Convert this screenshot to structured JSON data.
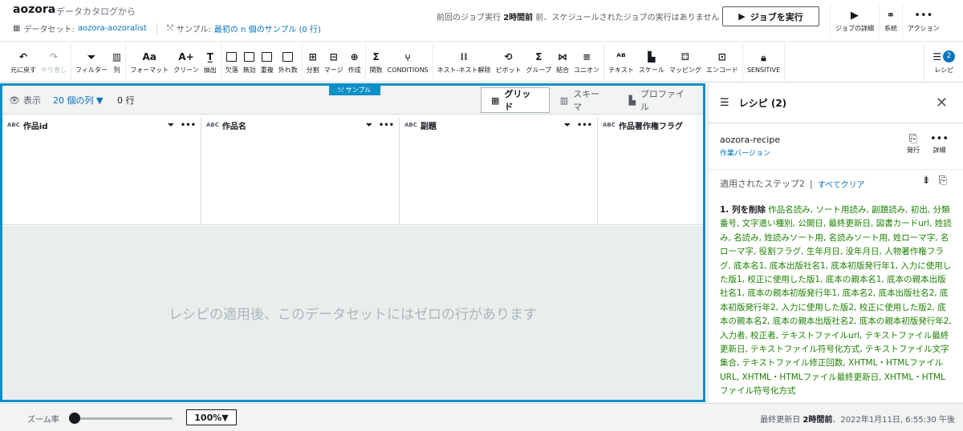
{
  "header": {
    "title": "aozora",
    "subtitle": "データカタログから",
    "dataset_label": "データセット:",
    "dataset_name": "aozora-aozoralist",
    "sample_label": "サンプル:",
    "sample_value": "最初の n 個のサンプル (0 行)",
    "job_status_prefix": "前回のジョブ実行",
    "job_status_time": "2時間前",
    "job_status_suffix": "前、スケジュールされたジョブの実行はありません",
    "run_job_label": "ジョブを実行",
    "actions": [
      {
        "icon": "▶",
        "label": "ジョブの詳細"
      },
      {
        "icon": "⚭",
        "label": "系統"
      },
      {
        "icon": "•••",
        "label": "アクション"
      }
    ]
  },
  "toolbar": {
    "undo": "元に戻す",
    "redo": "やり直し",
    "filter": "フィルター",
    "column": "列",
    "format": "フォーマット",
    "clean": "クリーン",
    "extract": "抽出",
    "missing": "欠落",
    "invalid": "無効",
    "duplicate": "重複",
    "outliers": "外れ数",
    "split": "分割",
    "merge": "マージ",
    "create": "作成",
    "functions": "関数",
    "conditions": "CONDITIONS",
    "nest": "ネスト-ネスト解除",
    "pivot": "ピボット",
    "group": "グループ",
    "join": "結合",
    "union": "ユニオン",
    "text": "テキスト",
    "scale": "スケール",
    "mapping": "マッピング",
    "encode": "エンコード",
    "sensitive": "SENSITIVE",
    "recipe": "レシピ",
    "recipe_count": "2"
  },
  "main": {
    "sample_tag": "サンプル",
    "show_label": "表示",
    "columns_dropdown": "20 個の列 ▼",
    "rows_label": "0 行",
    "tabs": [
      {
        "label": "グリッド",
        "icon": "grid-icon"
      },
      {
        "label": "スキーマ",
        "icon": "schema-icon"
      },
      {
        "label": "プロファイル",
        "icon": "profile-icon"
      }
    ],
    "columns": [
      {
        "type": "ABC",
        "name": "作品id"
      },
      {
        "type": "ABC",
        "name": "作品名"
      },
      {
        "type": "ABC",
        "name": "副題"
      },
      {
        "type": "ABC",
        "name": "作品著作権フラグ"
      }
    ],
    "empty_message": "レシピの適用後、このデータセットにはゼロの行があります"
  },
  "panel": {
    "title": "レシピ (2)",
    "recipe_name": "aozora-recipe",
    "recipe_version": "作業バージョン",
    "publish": "発行",
    "details": "詳細",
    "applied_steps": "適用されたステップ2",
    "clear_all": "すべてクリア",
    "step1_title": "1. 列を削除",
    "step1_body": "作品名読み, ソート用読み, 副題読み, 初出, 分類番号, 文字遣い種別, 公開日, 最終更新日, 図書カードurl, 姓読み, 名読み, 姓読みソート用, 名読みソート用, 姓ローマ字, 名ローマ字, 役割フラグ, 生年月日, 没年月日, 人物著作権フラグ, 底本名1, 底本出版社名1, 底本初版発行年1, 入力に使用した版1, 校正に使用した版1, 底本の親本名1, 底本の親本出版社名1, 底本の親本初版発行年1, 底本名2, 底本出版社名2, 底本初版発行年2, 入力に使用した版2, 校正に使用した版2, 底本の親本名2, 底本の親本出版社名2, 底本の親本初版発行年2, 入力者, 校正者, テキストファイルurl, テキストファイル最終更新日, テキストファイル符号化方式, テキストファイル文字集合, テキストファイル修正回数, XHTML・HTMLファイルURL, XHTML・HTMLファイル最終更新日, XHTML・HTMLファイル符号化方式"
  },
  "footer": {
    "zoom_label": "ズーム率",
    "zoom_level": 0.0,
    "zoom_value": "100%▼",
    "updated_label": "最終更新日",
    "updated_time": "2時間前",
    "updated_date": "、2022年1月11日, 6:55:30 午後"
  }
}
